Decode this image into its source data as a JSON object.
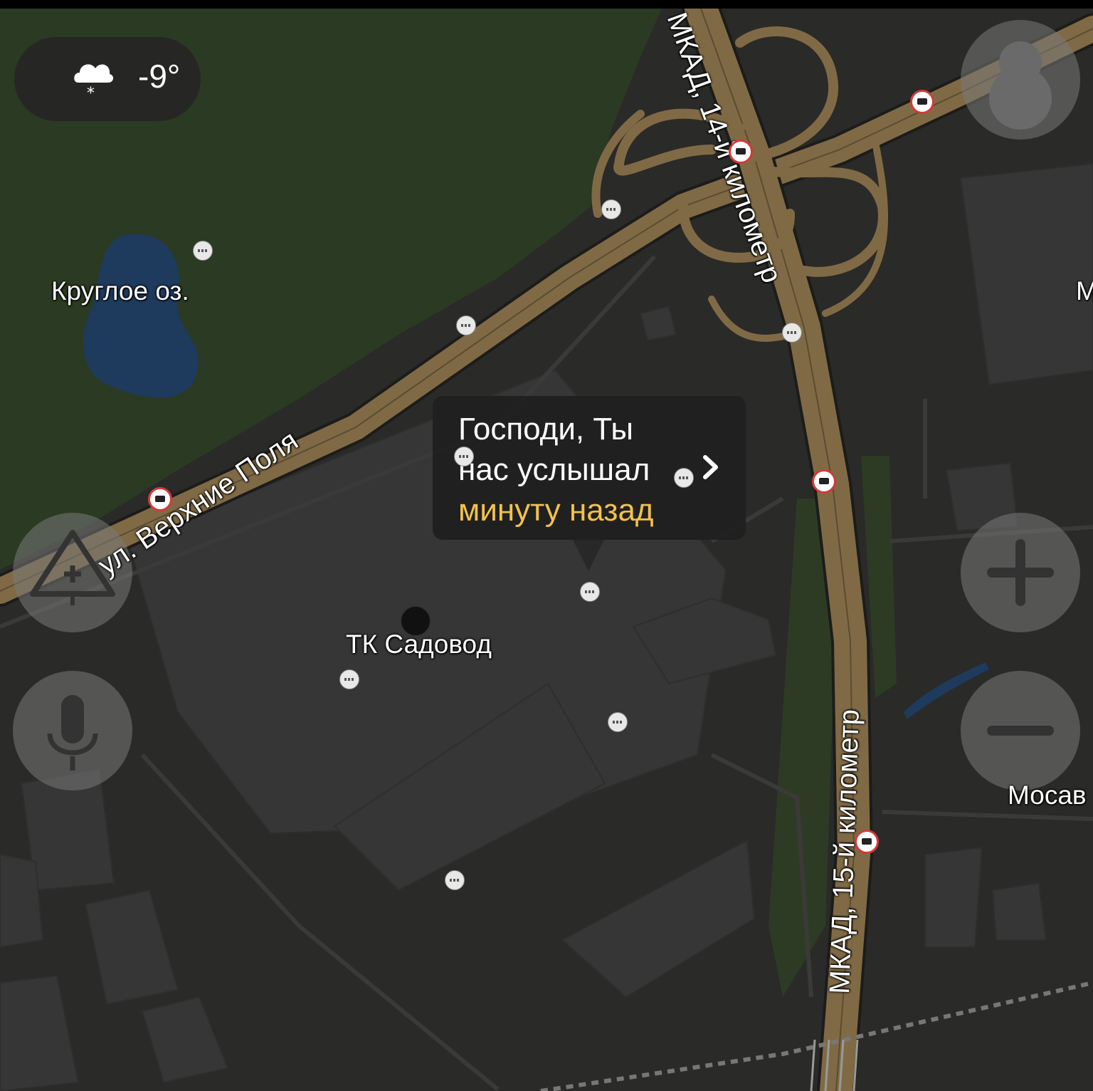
{
  "weather": {
    "icon": "snow-cloud-icon",
    "temperature": "-9°"
  },
  "bubble": {
    "line1": "Господи, Ты",
    "line2": "нас услышал",
    "time_ago": "минуту назад",
    "icon": "chevron-right-icon"
  },
  "labels": {
    "lake": "Круглое оз.",
    "mall": "ТК Садовод",
    "street": "ул. Верхние Поля",
    "mkad14": "МКАД, 14-й километр",
    "mkad15": "МКАД, 15-й километр",
    "east_edge_1": "М",
    "east_edge_2": "Мосав"
  },
  "controls": {
    "profile": "profile-icon",
    "report": "add-road-event-icon",
    "voice": "microphone-icon",
    "zoom_in": "plus-icon",
    "zoom_out": "minus-icon"
  },
  "colors": {
    "forest": "#2b3a22",
    "land": "#2a2a28",
    "building": "#363636",
    "road": "#806a45",
    "water": "#1e3a5c",
    "accent": "#f3c14c",
    "camera": "#d23a3a"
  }
}
